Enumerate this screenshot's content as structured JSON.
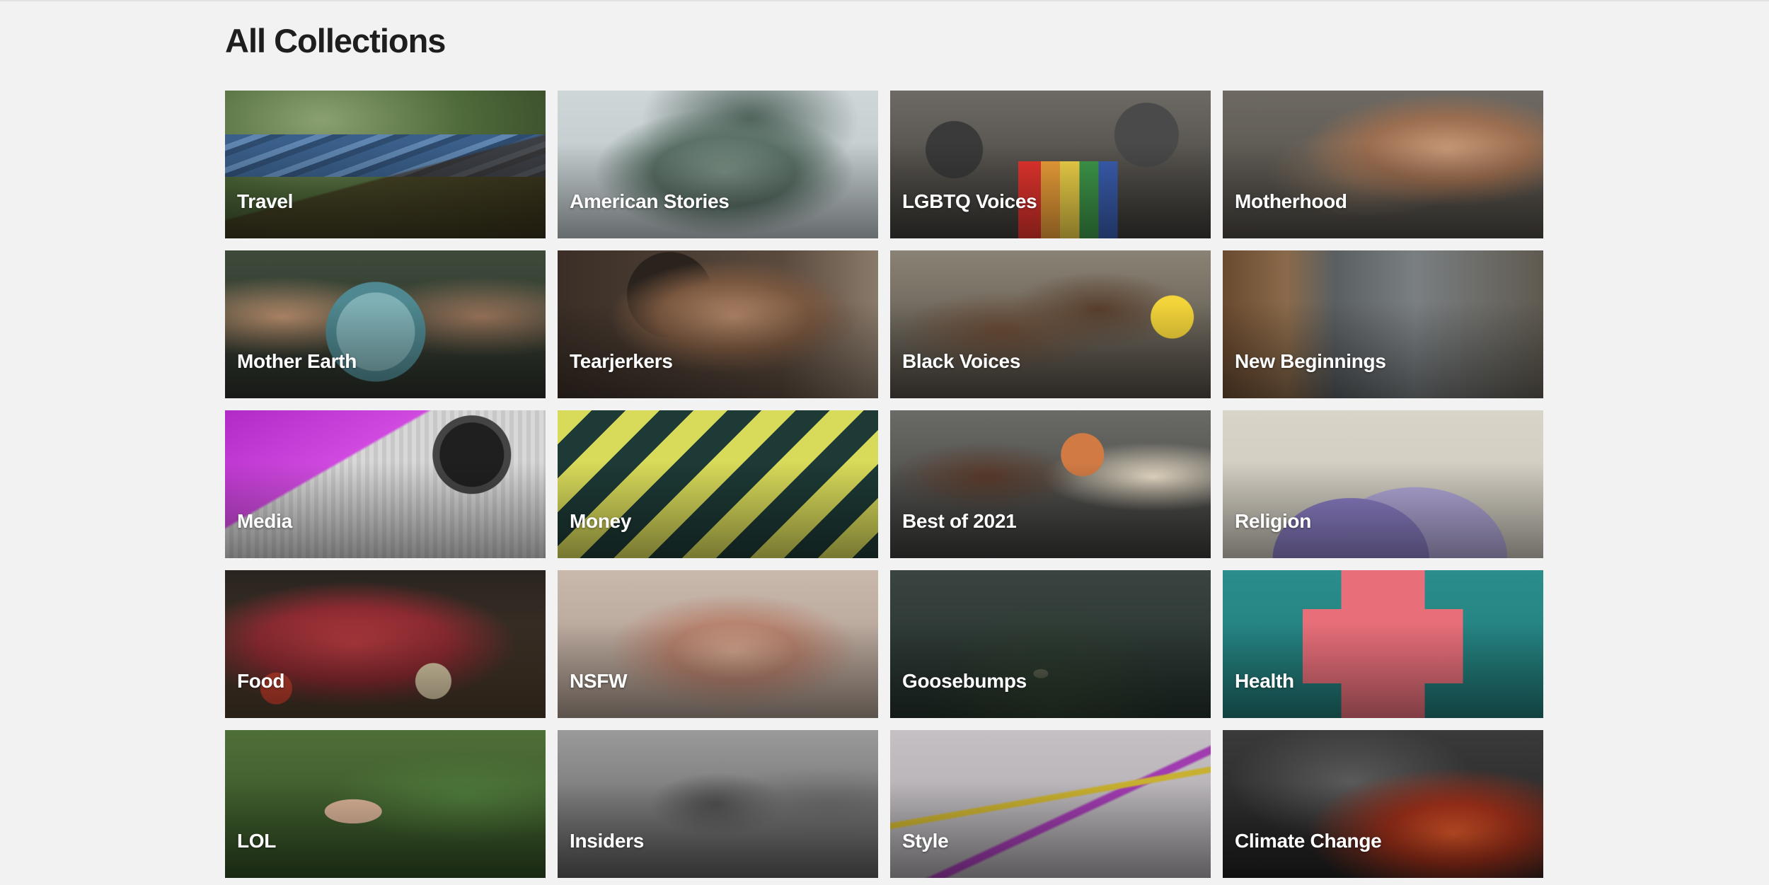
{
  "page": {
    "title": "All Collections"
  },
  "collections": [
    {
      "label": "Travel",
      "art": "a-travel"
    },
    {
      "label": "American Stories",
      "art": "a-american"
    },
    {
      "label": "LGBTQ Voices",
      "art": "a-lgbtq"
    },
    {
      "label": "Motherhood",
      "art": "a-mother"
    },
    {
      "label": "Mother Earth",
      "art": "a-earth"
    },
    {
      "label": "Tearjerkers",
      "art": "a-tear"
    },
    {
      "label": "Black Voices",
      "art": "a-black"
    },
    {
      "label": "New Beginnings",
      "art": "a-begin"
    },
    {
      "label": "Media",
      "art": "a-media"
    },
    {
      "label": "Money",
      "art": "a-money"
    },
    {
      "label": "Best of 2021",
      "art": "a-best"
    },
    {
      "label": "Religion",
      "art": "a-religion"
    },
    {
      "label": "Food",
      "art": "a-food"
    },
    {
      "label": "NSFW",
      "art": "a-nsfw"
    },
    {
      "label": "Goosebumps",
      "art": "a-goose"
    },
    {
      "label": "Health",
      "art": "a-health"
    },
    {
      "label": "LOL",
      "art": "a-lol"
    },
    {
      "label": "Insiders",
      "art": "a-insiders"
    },
    {
      "label": "Style",
      "art": "a-style"
    },
    {
      "label": "Climate Change",
      "art": "a-climate"
    }
  ]
}
